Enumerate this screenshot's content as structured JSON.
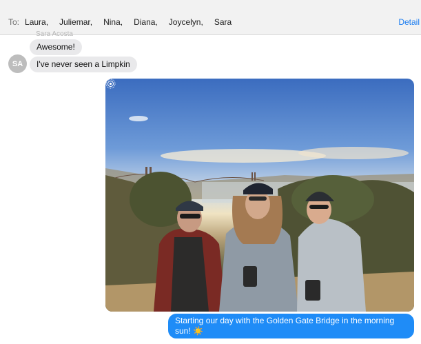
{
  "header": {
    "to_label": "To:",
    "recipients": [
      "Laura,",
      "Juliemar,",
      "Nina,",
      "Diana,",
      "Joycelyn,",
      "Sara"
    ],
    "details_label": "Detail"
  },
  "messages": {
    "faded_sender": "Sara Acosta",
    "incoming": [
      {
        "text": "Awesome!"
      },
      {
        "text": "I've never seen a Limpkin"
      }
    ],
    "avatar_initials": "SA",
    "outgoing_text": "Starting our day with the Golden Gate Bridge in the morning sun! ☀️"
  },
  "icons": {
    "live_photo": "live-photo-icon"
  },
  "colors": {
    "outgoing_bubble": "#1f8cf7",
    "incoming_bubble": "#e9e9eb",
    "link": "#1a7cf0"
  }
}
